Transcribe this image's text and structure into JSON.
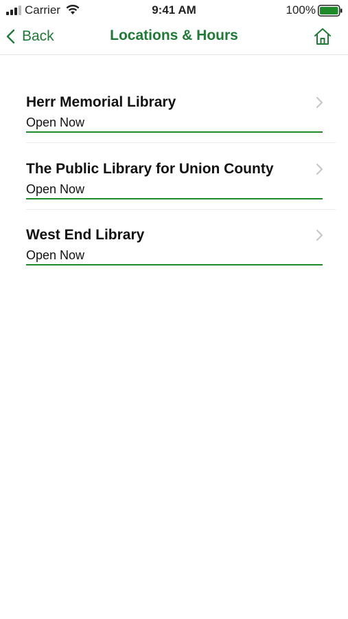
{
  "status_bar": {
    "carrier": "Carrier",
    "time": "9:41 AM",
    "battery": "100%"
  },
  "nav": {
    "back_label": "Back",
    "title": "Locations & Hours"
  },
  "locations": [
    {
      "name": "Herr Memorial Library",
      "status": "Open Now"
    },
    {
      "name": "The Public Library for Union County",
      "status": "Open Now"
    },
    {
      "name": "West End Library",
      "status": "Open Now"
    }
  ],
  "colors": {
    "accent": "#1f7a35",
    "underline": "#1e8a2a",
    "chevron": "#c4c4c7"
  },
  "icons": {
    "signal": "cellular-signal-icon",
    "wifi": "wifi-icon",
    "battery": "battery-icon",
    "back": "chevron-left-icon",
    "home": "home-icon",
    "row": "chevron-right-icon"
  }
}
